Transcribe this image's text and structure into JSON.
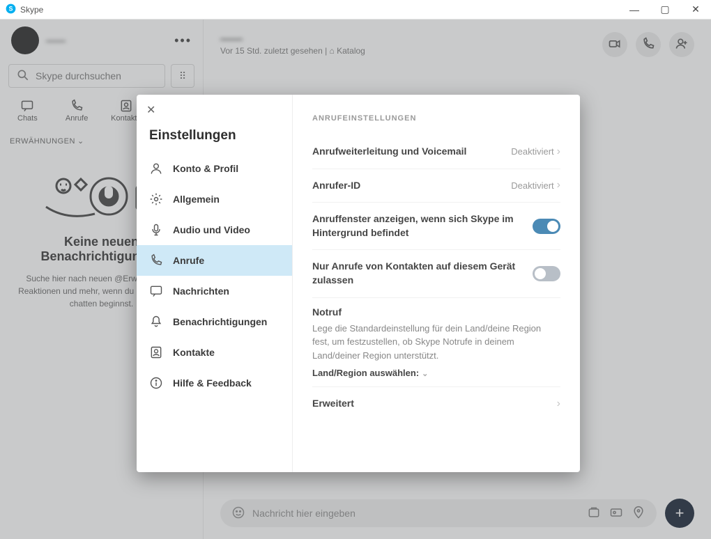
{
  "window": {
    "title": "Skype"
  },
  "sidebar": {
    "user_name": "——",
    "search_placeholder": "Skype durchsuchen",
    "tabs": [
      {
        "label": "Chats"
      },
      {
        "label": "Anrufe"
      },
      {
        "label": "Kontakte"
      },
      {
        "label": "—"
      }
    ],
    "filter_label": "ERWÄHNUNGEN",
    "empty_title": "Keine neuen Benachrichtigungen",
    "empty_body": "Suche hier nach neuen @Erwähnungen, Reaktionen und mehr, wenn du auf Skype zu chatten beginnst."
  },
  "chat": {
    "contact_name": "——",
    "meta": "Vor 15 Std. zuletzt gesehen  |  ⌂ Katalog",
    "message_placeholder": "Nachricht hier eingeben"
  },
  "settings": {
    "title": "Einstellungen",
    "nav": [
      {
        "label": "Konto & Profil"
      },
      {
        "label": "Allgemein"
      },
      {
        "label": "Audio und Video"
      },
      {
        "label": "Anrufe"
      },
      {
        "label": "Nachrichten"
      },
      {
        "label": "Benachrichtigungen"
      },
      {
        "label": "Kontakte"
      },
      {
        "label": "Hilfe & Feedback"
      }
    ],
    "section_heading": "ANRUFEINSTELLUNGEN",
    "rows": {
      "fwd": {
        "label": "Anrufweiterleitung und Voicemail",
        "status": "Deaktiviert"
      },
      "cid": {
        "label": "Anrufer-ID",
        "status": "Deaktiviert"
      },
      "show_window": {
        "label": "Anruffenster anzeigen, wenn sich Skype im Hintergrund befindet",
        "on": true
      },
      "only_contacts": {
        "label": "Nur Anrufe von Kontakten auf diesem Gerät zulassen",
        "on": false
      },
      "emergency": {
        "label": "Notruf",
        "desc": "Lege die Standardeinstellung für dein Land/deine Region fest, um festzustellen, ob Skype Notrufe in deinem Land/deiner Region unterstützt.",
        "selector": "Land/Region auswählen:"
      },
      "advanced": {
        "label": "Erweitert"
      }
    }
  }
}
